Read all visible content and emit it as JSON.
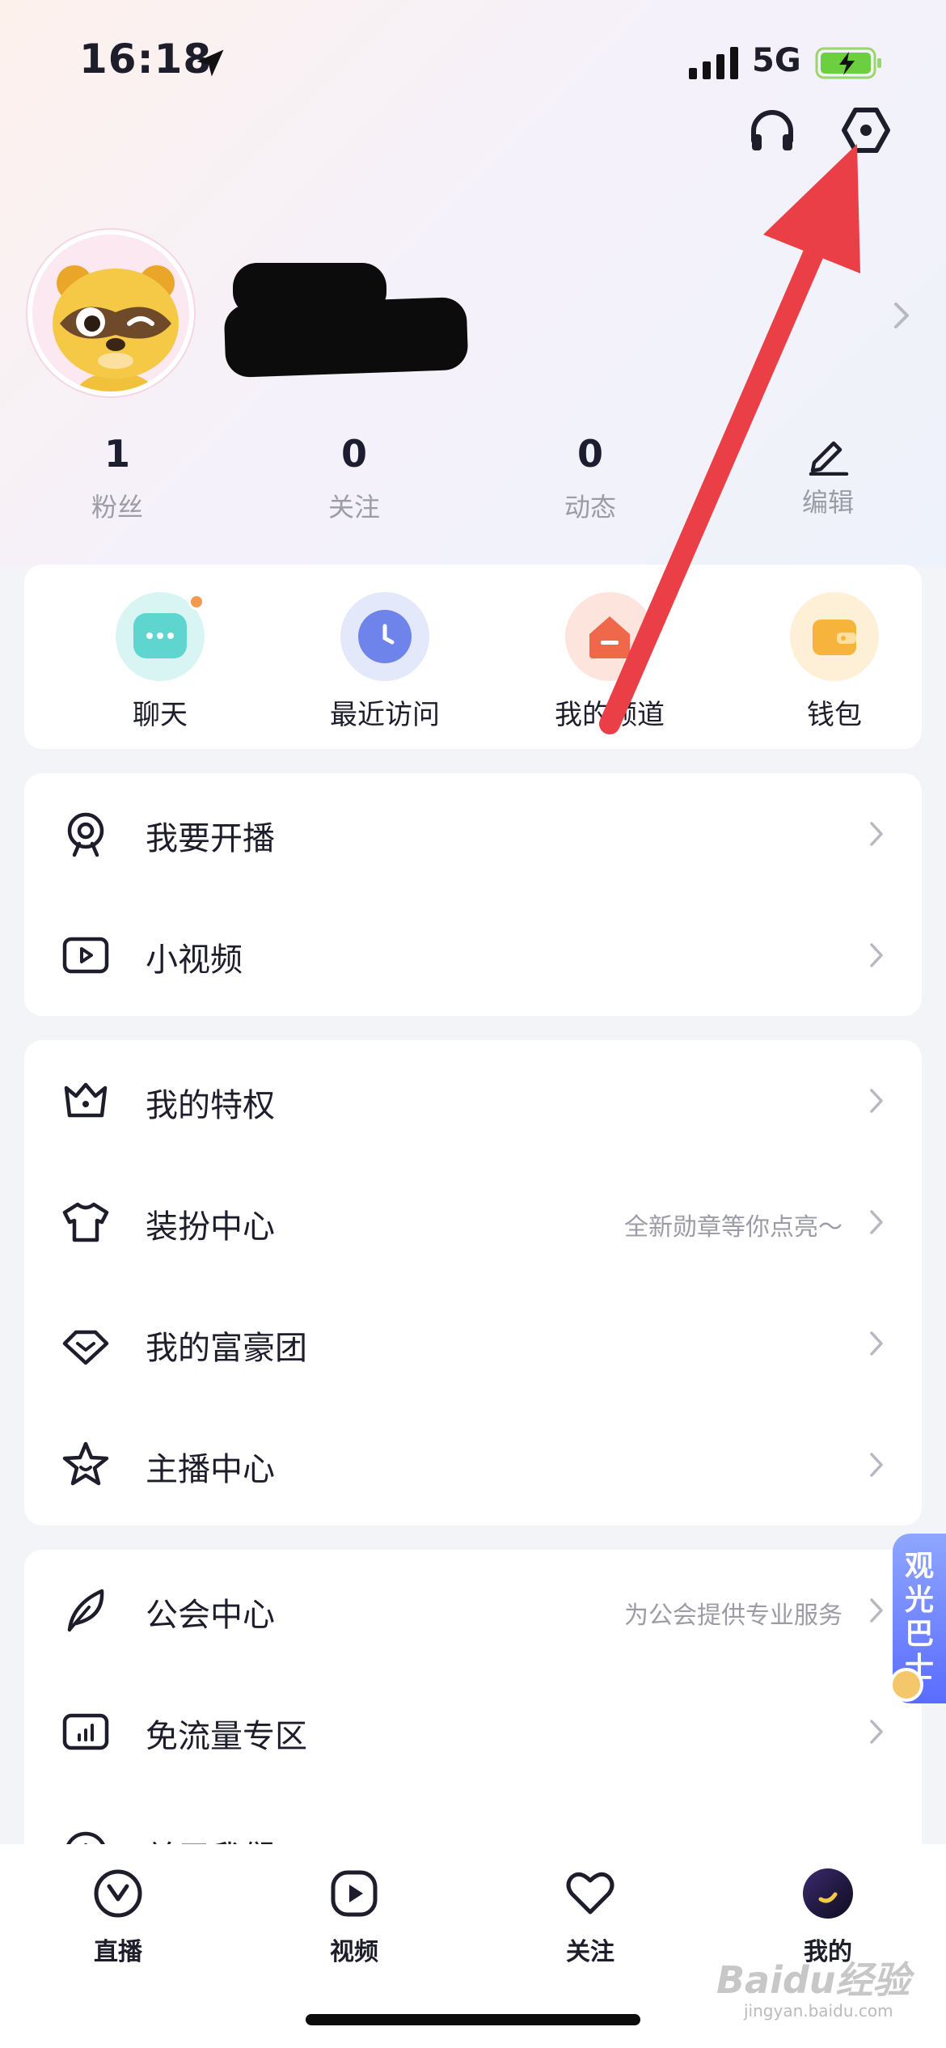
{
  "status_bar": {
    "time": "16:18",
    "network": "5G"
  },
  "profile": {
    "stats": [
      {
        "num": "1",
        "label": "粉丝"
      },
      {
        "num": "0",
        "label": "关注"
      },
      {
        "num": "0",
        "label": "动态"
      }
    ],
    "edit_label": "编辑"
  },
  "quick_actions": [
    {
      "label": "聊天",
      "icon": "chat-icon"
    },
    {
      "label": "最近访问",
      "icon": "clock-icon"
    },
    {
      "label": "我的频道",
      "icon": "channel-icon"
    },
    {
      "label": "钱包",
      "icon": "wallet-icon"
    }
  ],
  "menu_group_1": [
    {
      "label": "我要开播",
      "icon": "webcam-icon"
    },
    {
      "label": "小视频",
      "icon": "play-box-icon"
    }
  ],
  "menu_group_2": [
    {
      "label": "我的特权",
      "icon": "crown-icon"
    },
    {
      "label": "装扮中心",
      "sub": "全新勋章等你点亮～",
      "icon": "shirt-icon"
    },
    {
      "label": "我的富豪团",
      "icon": "diamond-icon"
    },
    {
      "label": "主播中心",
      "icon": "star-icon"
    }
  ],
  "menu_group_3": [
    {
      "label": "公会中心",
      "sub": "为公会提供专业服务",
      "icon": "feather-icon"
    },
    {
      "label": "免流量专区",
      "icon": "data-icon"
    },
    {
      "label": "关于我们",
      "icon": "info-icon"
    }
  ],
  "floating": {
    "label": "观光巴士"
  },
  "tabs": [
    {
      "label": "直播",
      "icon": "live-icon"
    },
    {
      "label": "视频",
      "icon": "video-icon"
    },
    {
      "label": "关注",
      "icon": "heart-icon"
    },
    {
      "label": "我的",
      "icon": "avatar-icon"
    }
  ],
  "watermark": {
    "brand": "Baidu经验",
    "url": "jingyan.baidu.com"
  },
  "colors": {
    "accent": "#5a6cff",
    "annotation_arrow": "#ea3f47"
  }
}
